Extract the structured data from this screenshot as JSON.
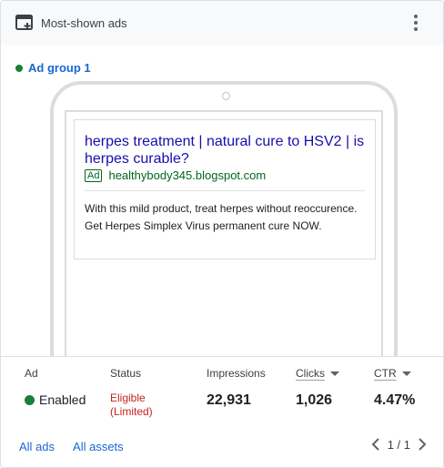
{
  "header": {
    "title": "Most-shown ads",
    "icon": "add-to-window-icon",
    "menu_icon": "more-vert-icon"
  },
  "ad_group": {
    "label": "Ad group 1",
    "status_color": "#188038"
  },
  "ad_preview": {
    "headline": "herpes treatment | natural cure to HSV2 | is herpes curable?",
    "badge": "Ad",
    "display_url": "healthybody345.blogspot.com",
    "description": "With this mild product, treat herpes without reoccurence. Get Herpes Simplex Virus permanent cure NOW."
  },
  "stats": {
    "ad_header": "Ad",
    "ad_value": "Enabled",
    "status_header": "Status",
    "status_value_line1": "Eligible",
    "status_value_line2": "(Limited)",
    "impressions_header": "Impressions",
    "impressions_value": "22,931",
    "clicks_header": "Clicks",
    "clicks_value": "1,026",
    "ctr_header": "CTR",
    "ctr_value": "4.47%"
  },
  "footer": {
    "all_ads": "All ads",
    "all_assets": "All assets",
    "page_indicator": "1 / 1"
  },
  "colors": {
    "link": "#1967d2",
    "ad_headline": "#1a0dab",
    "ad_url": "#006621",
    "limited": "#c5221f",
    "enabled": "#188038"
  }
}
